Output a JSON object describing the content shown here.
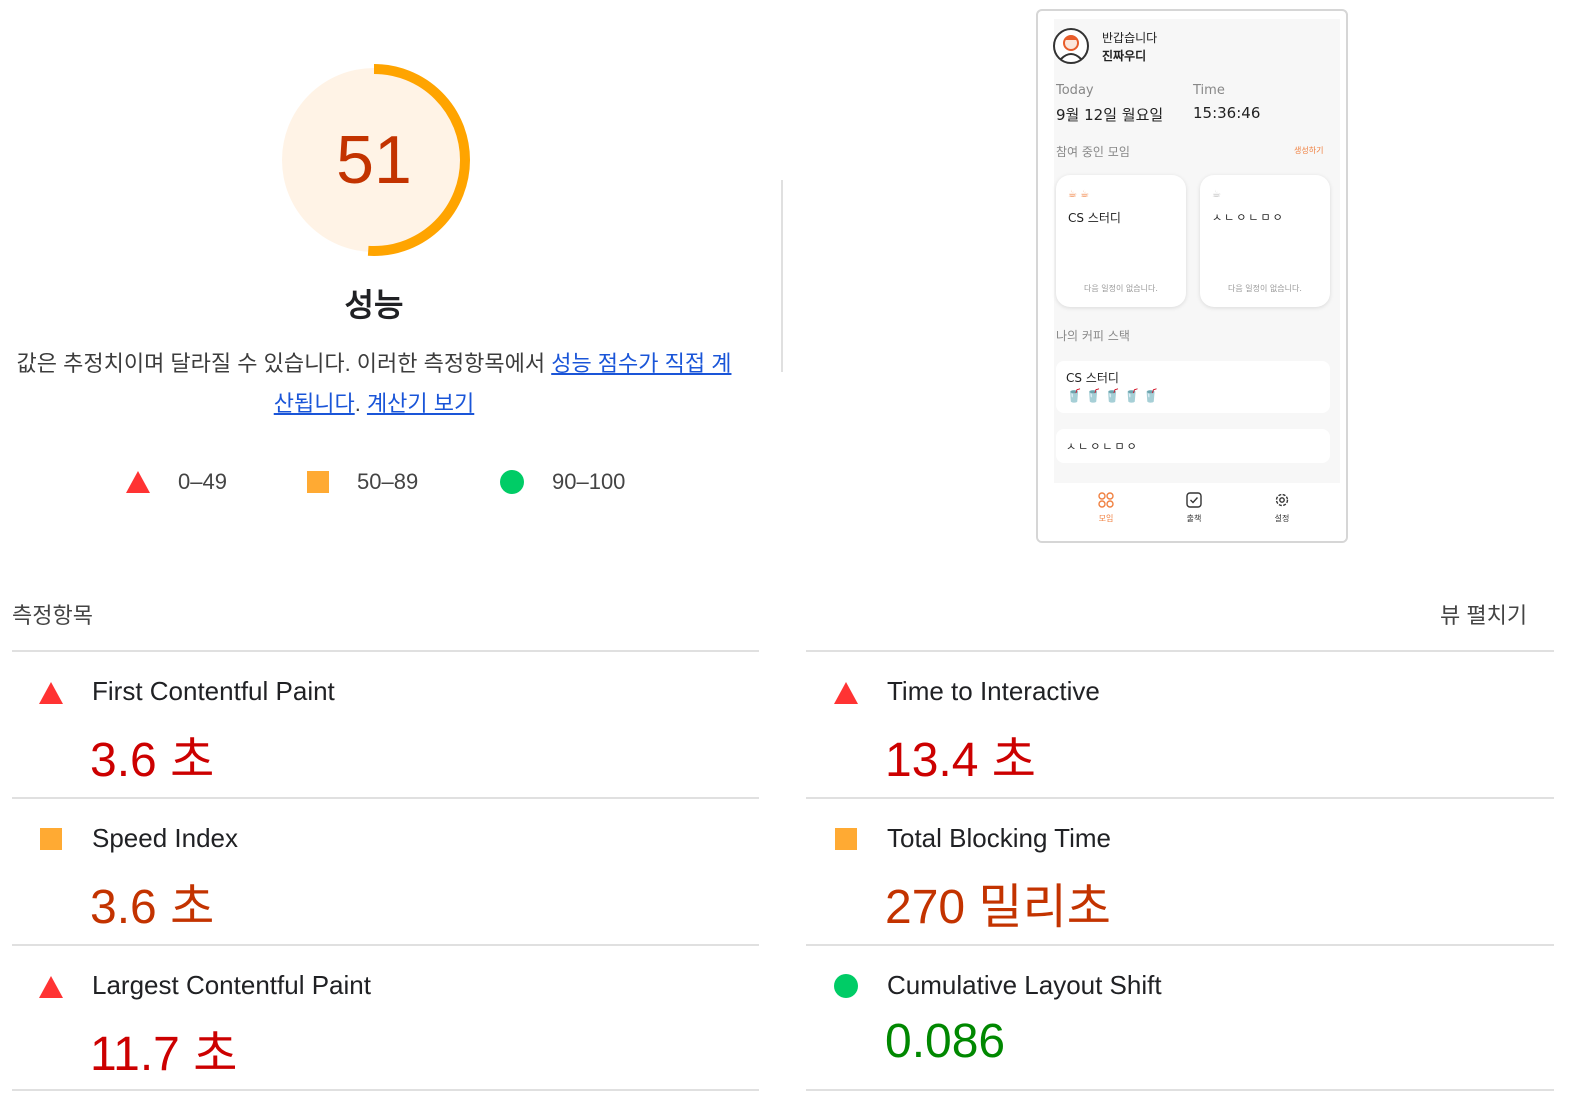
{
  "score": {
    "value": "51",
    "fraction": 0.51,
    "label": "성능",
    "color": "#ffa400"
  },
  "description": {
    "text": "값은 추정치이며 달라질 수 있습니다. 이러한 측정항목에서 ",
    "link1": "성능 점수가 직접 계산됩니다",
    "sep": ". ",
    "link2": "계산기 보기"
  },
  "legend": [
    {
      "shape": "triangle",
      "range": "0–49",
      "color": "#ff3333"
    },
    {
      "shape": "square",
      "range": "50–89",
      "color": "#ffaa33"
    },
    {
      "shape": "circle",
      "range": "90–100",
      "color": "#00cc66"
    }
  ],
  "phone": {
    "greeting": "반갑습니다",
    "username": "진짜우디",
    "today_label": "Today",
    "today_value": "9월 12일 월요일",
    "time_label": "Time",
    "time_value": "15:36:46",
    "section1": "참여 중인 모임",
    "create": "생성하기",
    "cards": [
      {
        "title": "CS 스터디",
        "empty": "다음 일정이 없습니다."
      },
      {
        "title": "ㅅㄴㅇㄴㅁㅇ",
        "empty": "다음 일정이 없습니다."
      }
    ],
    "section2": "나의 커피 스택",
    "stacks": [
      {
        "title": "CS 스터디",
        "cups": 5
      },
      {
        "title": "ㅅㄴㅇㄴㅁㅇ",
        "cups": 0
      }
    ],
    "nav": [
      {
        "icon": "grid-icon",
        "label": "모임",
        "active": true
      },
      {
        "icon": "check-icon",
        "label": "출책",
        "active": false
      },
      {
        "icon": "gear-icon",
        "label": "설정",
        "active": false
      }
    ]
  },
  "metrics_title": "측정항목",
  "expand_label": "뷰 펼치기",
  "metrics": [
    {
      "id": "fcp",
      "name": "First Contentful Paint",
      "value": "3.6 초",
      "rating": "fail"
    },
    {
      "id": "tti",
      "name": "Time to Interactive",
      "value": "13.4 초",
      "rating": "fail"
    },
    {
      "id": "si",
      "name": "Speed Index",
      "value": "3.6 초",
      "rating": "average"
    },
    {
      "id": "tbt",
      "name": "Total Blocking Time",
      "value": "270 밀리초",
      "rating": "average"
    },
    {
      "id": "lcp",
      "name": "Largest Contentful Paint",
      "value": "11.7 초",
      "rating": "fail"
    },
    {
      "id": "cls",
      "name": "Cumulative Layout Shift",
      "value": "0.086",
      "rating": "pass"
    }
  ]
}
